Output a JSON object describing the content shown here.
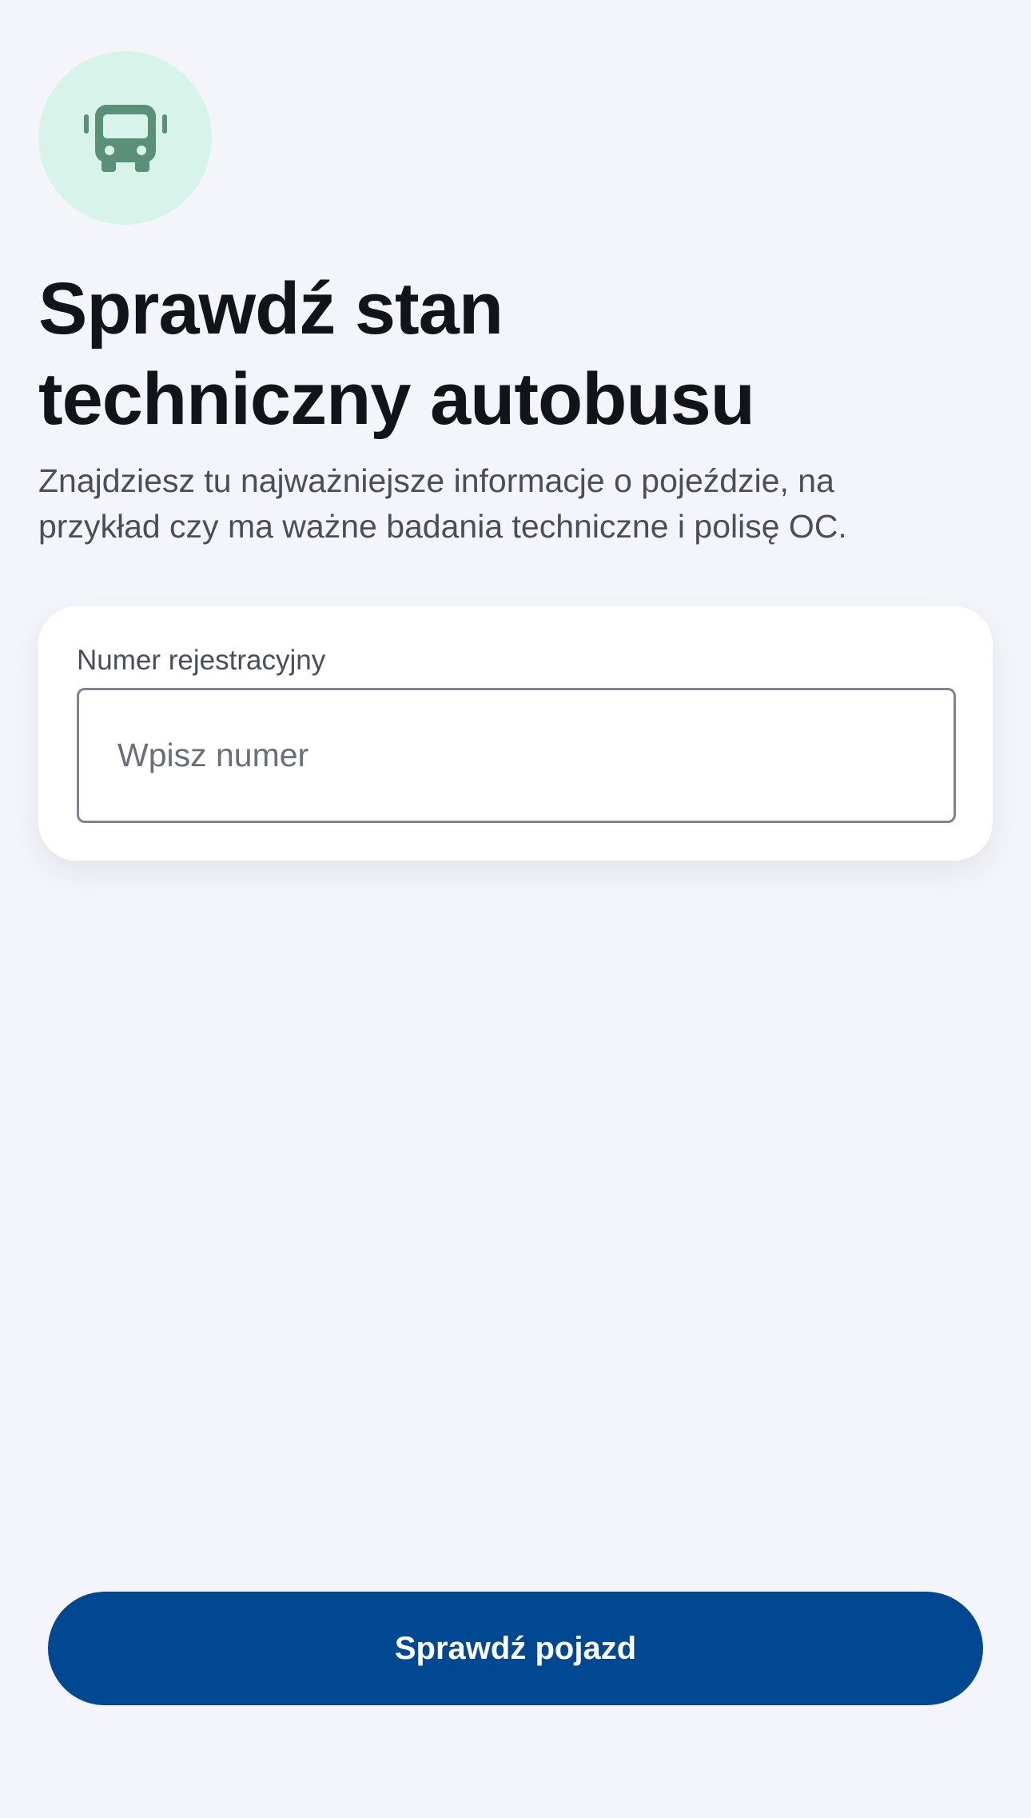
{
  "header": {
    "icon": "bus-icon",
    "icon_color": "#5a9078",
    "icon_background": "#d8f3e9",
    "title_line1": "Sprawdź stan",
    "title_line2": "techniczny autobusu",
    "subtitle_line1": "Znajdziesz tu najważniejsze informacje o pojeździe, na",
    "subtitle_line2": "przykład czy ma ważne badania techniczne i polisę OC."
  },
  "form": {
    "registration_label": "Numer rejestracyjny",
    "registration_placeholder": "Wpisz numer",
    "registration_value": ""
  },
  "actions": {
    "check_vehicle_label": "Sprawdź pojazd",
    "accent_color": "#004892"
  }
}
